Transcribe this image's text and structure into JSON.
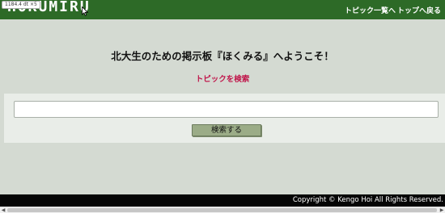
{
  "size_tooltip": "1184.4 dt ×5",
  "navbar": {
    "brand": "HOKUMIRU",
    "links": [
      {
        "label": "トピック一覧へ"
      },
      {
        "label": "トップへ戻る"
      }
    ],
    "colors": {
      "background": "#2d6a27",
      "text": "#ffffff"
    }
  },
  "main": {
    "welcome": "北大生のための掲示板『ほくみる』へようこそ！",
    "subtitle": "トピックを検索",
    "subtitle_color": "#c0154a"
  },
  "search": {
    "value": "",
    "placeholder": "",
    "button_label": "検索する"
  },
  "footer": {
    "copyright": "Copyright © Kengo Hoi All Rights Reserved."
  },
  "icons": {
    "cursor": "mouse-pointer-icon",
    "scroll_left": "scroll-left-arrow-icon",
    "scroll_right": "scroll-right-arrow-icon"
  }
}
